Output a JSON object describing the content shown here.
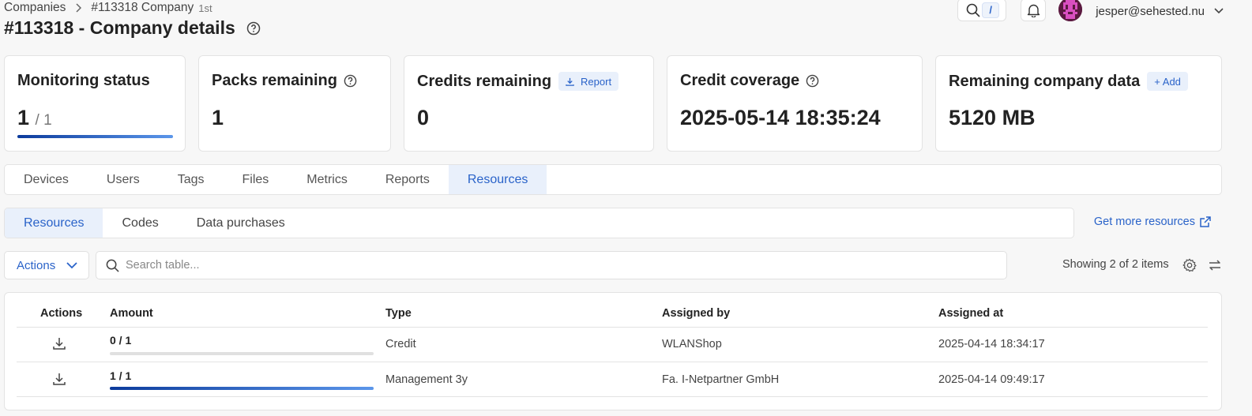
{
  "breadcrumb": {
    "root": "Companies",
    "current": "#113318 Company",
    "current_tag": "1st"
  },
  "page": {
    "title": "#113318 - Company details"
  },
  "topbar": {
    "search_shortcut": "/",
    "user_email": "jesper@sehested.nu"
  },
  "cards": {
    "monitoring": {
      "title": "Monitoring status",
      "value": "1",
      "total": "/ 1",
      "progress": 1.0
    },
    "packs": {
      "title": "Packs remaining",
      "value": "1"
    },
    "credits": {
      "title": "Credits remaining",
      "button": "Report",
      "value": "0"
    },
    "coverage": {
      "title": "Credit coverage",
      "value": "2025-05-14 18:35:24"
    },
    "data": {
      "title": "Remaining company data",
      "button": "+ Add",
      "value": "5120 MB"
    }
  },
  "tabs": [
    "Devices",
    "Users",
    "Tags",
    "Files",
    "Metrics",
    "Reports",
    "Resources"
  ],
  "active_tab": "Resources",
  "subtabs": [
    "Resources",
    "Codes",
    "Data purchases"
  ],
  "active_subtab": "Resources",
  "more_resources_link": "Get more resources",
  "toolbar": {
    "actions_label": "Actions",
    "search_placeholder": "Search table...",
    "showing": "Showing 2 of 2 items"
  },
  "table": {
    "columns": [
      "Actions",
      "Amount",
      "Type",
      "Assigned by",
      "Assigned at"
    ],
    "rows": [
      {
        "amount": "0 / 1",
        "progress": 0.0,
        "type": "Credit",
        "assigned_by": "WLANShop",
        "assigned_at": "2025-04-14 18:34:17"
      },
      {
        "amount": "1 / 1",
        "progress": 1.0,
        "type": "Management 3y",
        "assigned_by": "Fa. I-Netpartner GmbH",
        "assigned_at": "2025-04-14 09:49:17"
      }
    ]
  },
  "colors": {
    "accent": "#2a63c9",
    "active_bg": "#e9f0fb",
    "bar_start": "#0c3b9c",
    "bar_end": "#5b96ea"
  }
}
